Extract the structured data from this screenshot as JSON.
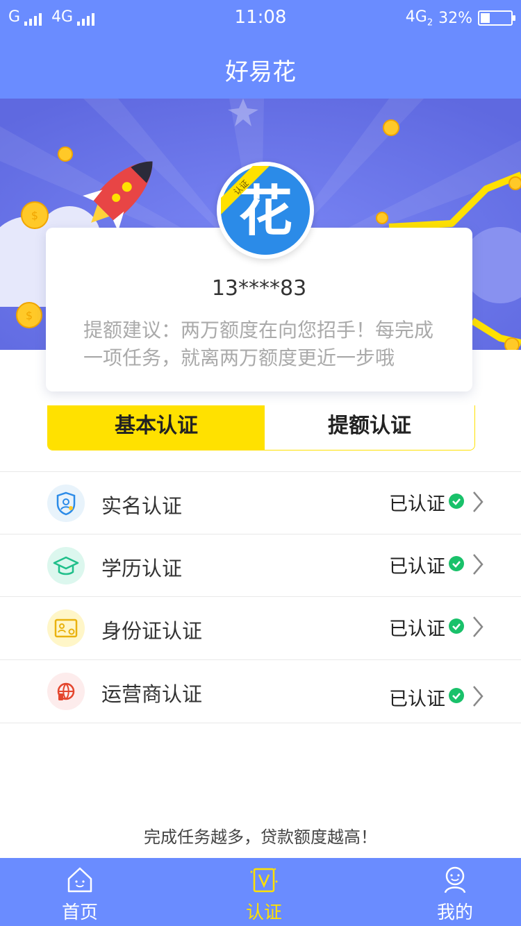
{
  "status_bar": {
    "carrier1": "G",
    "carrier2": "4G",
    "time": "11:08",
    "network": "4G",
    "network_sub": "2",
    "battery": "32%",
    "battery_level": 0.32
  },
  "header": {
    "title": "好易花"
  },
  "card": {
    "badge": "认证",
    "avatar_char": "花",
    "phone": "13****83",
    "tip": "提额建议：两万额度在向您招手！每完成一项任务，就离两万额度更近一步哦"
  },
  "tabs": [
    {
      "label": "基本认证",
      "active": true
    },
    {
      "label": "提额认证",
      "active": false
    }
  ],
  "verify_items": [
    {
      "label": "实名认证",
      "status": "已认证",
      "icon": "shield-user-icon",
      "icon_bg": "#e8f3fb",
      "icon_color": "#2b8be8"
    },
    {
      "label": "学历认证",
      "status": "已认证",
      "icon": "graduation-cap-icon",
      "icon_bg": "#dcf7ee",
      "icon_color": "#1fbf8a"
    },
    {
      "label": "身份证认证",
      "status": "已认证",
      "icon": "id-card-icon",
      "icon_bg": "#fff6c8",
      "icon_color": "#e9b20e"
    },
    {
      "label": "运营商认证",
      "status": "已认证",
      "icon": "globe-phone-icon",
      "icon_bg": "#fdecec",
      "icon_color": "#e4452d"
    }
  ],
  "footer_text": "完成任务越多，贷款额度越高！",
  "bottom_nav": [
    {
      "label": "首页",
      "icon": "home-icon",
      "active": false
    },
    {
      "label": "认证",
      "icon": "verify-v-icon",
      "active": true
    },
    {
      "label": "我的",
      "icon": "user-icon",
      "active": false
    }
  ],
  "colors": {
    "primary": "#6a8cff",
    "accent_yellow": "#ffe100",
    "check_green": "#19c16a"
  }
}
